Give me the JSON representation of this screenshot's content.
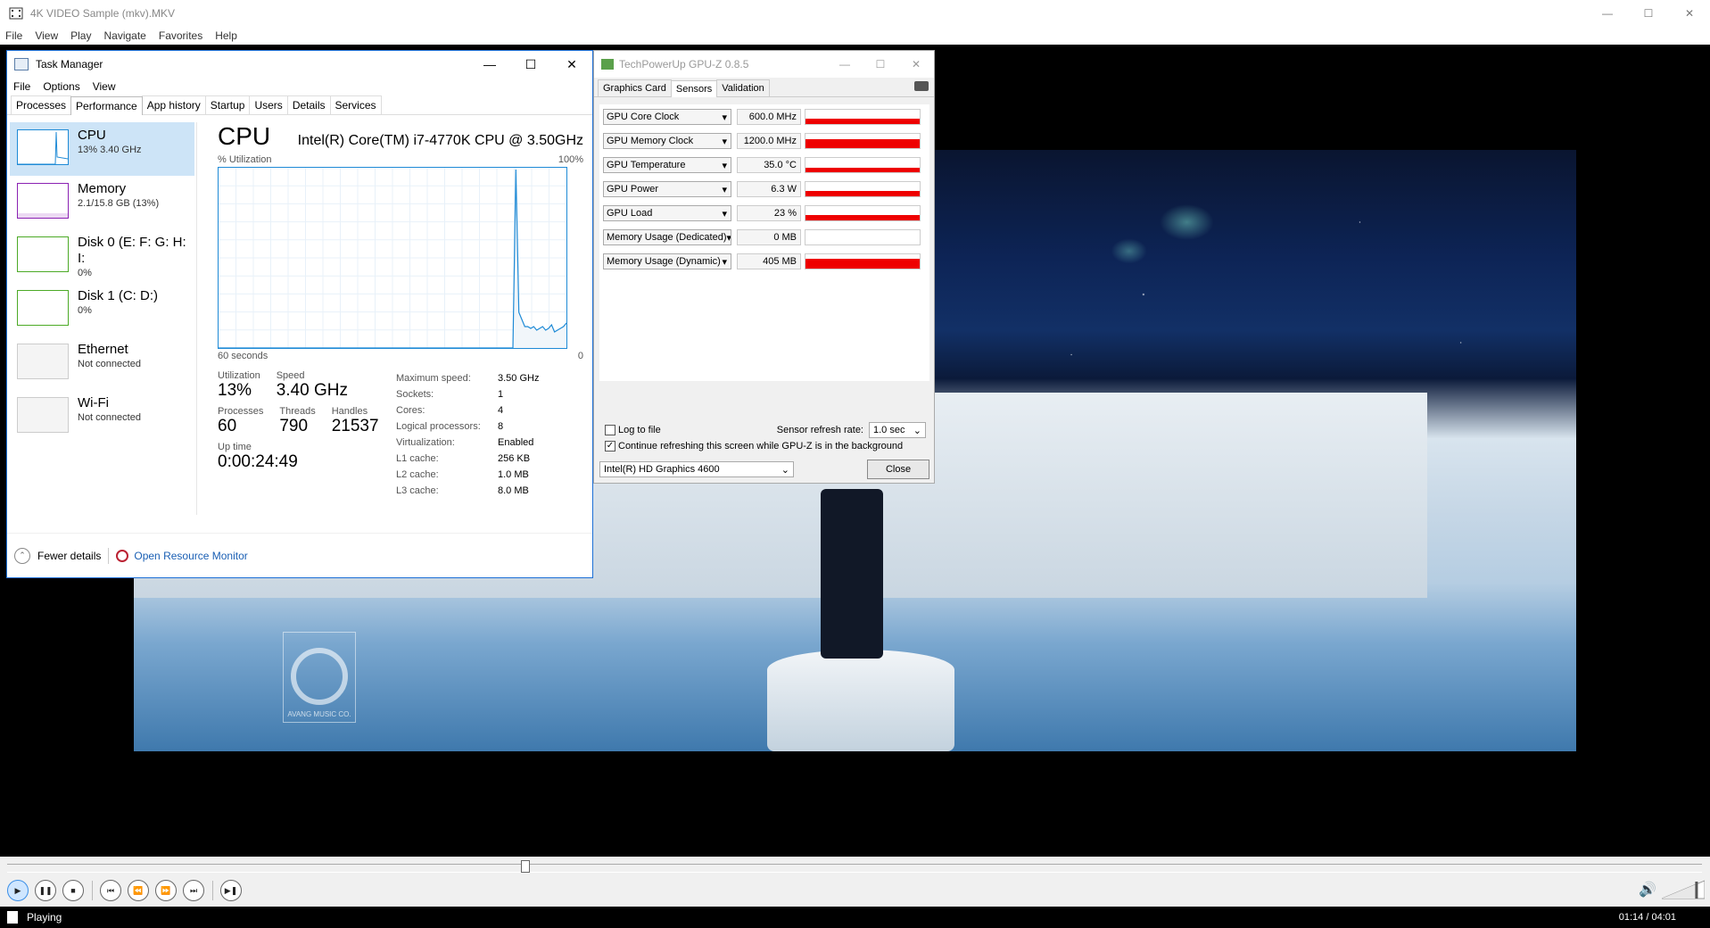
{
  "player": {
    "title": "4K VIDEO Sample (mkv).MKV",
    "menu": [
      "File",
      "View",
      "Play",
      "Navigate",
      "Favorites",
      "Help"
    ],
    "watermark_text": "AVANG MUSIC CO.",
    "seek_position_fraction": 0.305,
    "status": "Playing",
    "time": "01:14 / 04:01",
    "volume_fraction": 0.8
  },
  "taskmanager": {
    "title": "Task Manager",
    "menu": [
      "File",
      "Options",
      "View"
    ],
    "tabs": [
      "Processes",
      "Performance",
      "App history",
      "Startup",
      "Users",
      "Details",
      "Services"
    ],
    "active_tab": "Performance",
    "sidebar": [
      {
        "label": "CPU",
        "sub": "13%  3.40 GHz",
        "color": "#1e8ad6"
      },
      {
        "label": "Memory",
        "sub": "2.1/15.8 GB (13%)",
        "color": "#8b22b3"
      },
      {
        "label": "Disk 0 (E: F: G: H: I:",
        "sub": "0%",
        "color": "#4caa26"
      },
      {
        "label": "Disk 1 (C: D:)",
        "sub": "0%",
        "color": "#4caa26"
      },
      {
        "label": "Ethernet",
        "sub": "Not connected",
        "color": "#bbbbbb"
      },
      {
        "label": "Wi-Fi",
        "sub": "Not connected",
        "color": "#bbbbbb"
      }
    ],
    "cpu": {
      "heading": "CPU",
      "model": "Intel(R) Core(TM) i7-4770K CPU @ 3.50GHz",
      "util_label": "% Utilization",
      "max_label": "100%",
      "time_label": "60 seconds",
      "zero_label": "0",
      "utilization_history": [
        0,
        0,
        0,
        0,
        0,
        0,
        0,
        0,
        0,
        0,
        0,
        0,
        0,
        0,
        0,
        0,
        0,
        0,
        0,
        0,
        0,
        0,
        0,
        0,
        0,
        0,
        0,
        0,
        0,
        0,
        0,
        0,
        0,
        0,
        0,
        0,
        0,
        0,
        0,
        0,
        0,
        0,
        0,
        0,
        0,
        0,
        0,
        0,
        0,
        0,
        0,
        0,
        0,
        0,
        0,
        0,
        0,
        0,
        0,
        0,
        0,
        0,
        0,
        0,
        0,
        0,
        0,
        0,
        0,
        0,
        0,
        0,
        0,
        0,
        0,
        0,
        0,
        0,
        0,
        0,
        0,
        0,
        0,
        0,
        0,
        0,
        0,
        0,
        0,
        0,
        0,
        0,
        0,
        0,
        0,
        0,
        0,
        0,
        0,
        0,
        100,
        20,
        16,
        12,
        12,
        11,
        12,
        10,
        11,
        12,
        10,
        11,
        13,
        9,
        10,
        11,
        12,
        14
      ],
      "stats": {
        "utilization_label": "Utilization",
        "utilization": "13%",
        "speed_label": "Speed",
        "speed": "3.40 GHz",
        "processes_label": "Processes",
        "processes": "60",
        "threads_label": "Threads",
        "threads": "790",
        "handles_label": "Handles",
        "handles": "21537",
        "uptime_label": "Up time",
        "uptime": "0:00:24:49"
      },
      "specs": [
        {
          "k": "Maximum speed:",
          "v": "3.50 GHz"
        },
        {
          "k": "Sockets:",
          "v": "1"
        },
        {
          "k": "Cores:",
          "v": "4"
        },
        {
          "k": "Logical processors:",
          "v": "8"
        },
        {
          "k": "Virtualization:",
          "v": "Enabled"
        },
        {
          "k": "L1 cache:",
          "v": "256 KB"
        },
        {
          "k": "L2 cache:",
          "v": "1.0 MB"
        },
        {
          "k": "L3 cache:",
          "v": "8.0 MB"
        }
      ]
    },
    "footer": {
      "fewer": "Fewer details",
      "resmon": "Open Resource Monitor"
    }
  },
  "gpuz": {
    "title": "TechPowerUp GPU-Z 0.8.5",
    "tabs": [
      "Graphics Card",
      "Sensors",
      "Validation"
    ],
    "active_tab": "Sensors",
    "sensors": [
      {
        "name": "GPU Core Clock",
        "value": "600.0 MHz",
        "fill": 0.35
      },
      {
        "name": "GPU Memory Clock",
        "value": "1200.0 MHz",
        "fill": 0.6
      },
      {
        "name": "GPU Temperature",
        "value": "35.0 °C",
        "fill": 0.3
      },
      {
        "name": "GPU Power",
        "value": "6.3 W",
        "fill": 0.35
      },
      {
        "name": "GPU Load",
        "value": "23 %",
        "fill": 0.35
      },
      {
        "name": "Memory Usage (Dedicated)",
        "value": "0 MB",
        "fill": 0
      },
      {
        "name": "Memory Usage (Dynamic)",
        "value": "405 MB",
        "fill": 0.7
      }
    ],
    "log_to_file": "Log to file",
    "refresh_label": "Sensor refresh rate:",
    "refresh_value": "1.0 sec",
    "continue_label": "Continue refreshing this screen while GPU-Z is in the background",
    "continue_checked": true,
    "gpu_select": "Intel(R) HD Graphics 4600",
    "close": "Close"
  }
}
